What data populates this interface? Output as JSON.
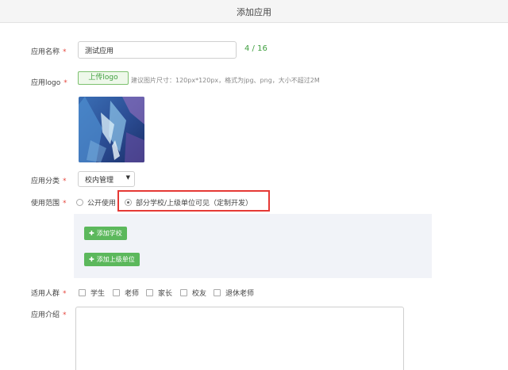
{
  "header": {
    "title": "添加应用"
  },
  "form": {
    "app_name": {
      "label": "应用名称",
      "value": "测试应用",
      "counter": "4 / 16"
    },
    "app_logo": {
      "label": "应用logo",
      "upload_label": "上传logo",
      "hint": "建议图片尺寸：120px*120px，格式为jpg、png，大小不超过2M"
    },
    "category": {
      "label": "应用分类",
      "selected": "校内管理"
    },
    "scope": {
      "label": "使用范围",
      "options": [
        {
          "label": "公开使用",
          "checked": false
        },
        {
          "label": "部分学校/上级单位可见（定制开发）",
          "checked": true
        }
      ],
      "add_school_label": "添加学校",
      "add_unit_label": "添加上级单位"
    },
    "audience": {
      "label": "适用人群",
      "options": [
        "学生",
        "老师",
        "家长",
        "校友",
        "退休老师"
      ]
    },
    "intro": {
      "label": "应用介绍"
    }
  },
  "required_mark": "*",
  "colors": {
    "accent_green": "#5cb85c",
    "required_red": "#e5463d",
    "highlight_red": "#e53935"
  }
}
